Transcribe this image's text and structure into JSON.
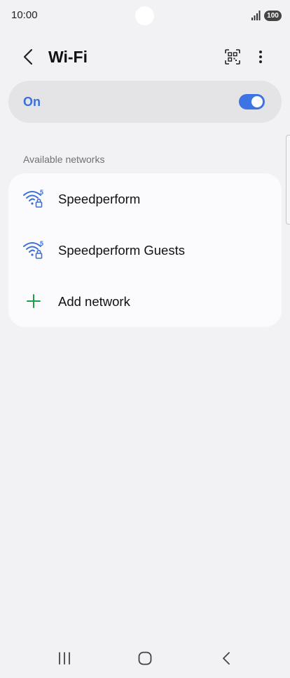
{
  "status_bar": {
    "time": "10:00",
    "battery": "100",
    "icons": [
      "signal-icon",
      "battery-icon"
    ]
  },
  "header": {
    "title": "Wi-Fi",
    "icons": [
      "back-arrow-icon",
      "qr-code-scan-icon",
      "more-vert-icon"
    ]
  },
  "master_switch": {
    "label": "On",
    "state": "on",
    "accent_color": "#3e73e4"
  },
  "available_networks": {
    "section_label": "Available networks",
    "items": [
      {
        "name": "Speedperform",
        "icon": "wifi-5ghz-secured-icon"
      },
      {
        "name": "Speedperform Guests",
        "icon": "wifi-5ghz-secured-icon"
      }
    ],
    "add_label": "Add network",
    "add_icon": "plus-icon",
    "add_icon_color": "#1f9e4a",
    "wifi_icon_color": "#3b6fd9"
  },
  "nav_bar": {
    "icons": [
      "recent-apps-icon",
      "home-icon",
      "back-icon"
    ]
  }
}
